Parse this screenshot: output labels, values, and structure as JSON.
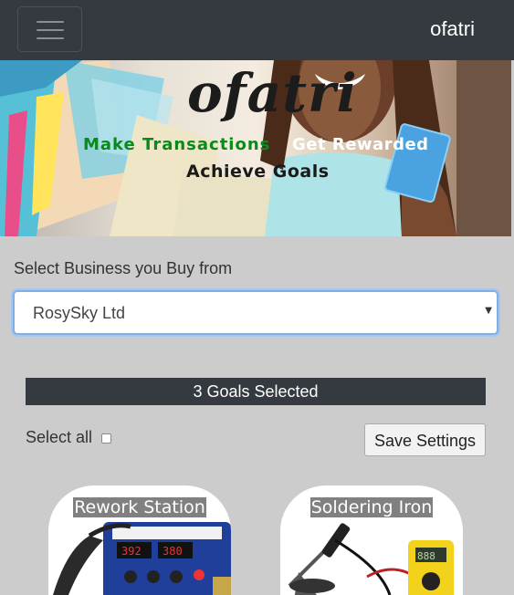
{
  "navbar": {
    "brand": "ofatri",
    "toggle_icon": "hamburger-menu-icon"
  },
  "hero": {
    "logo_text": "ofatri",
    "tagline_1": "Make Transactions",
    "tagline_2": "Get Rewarded",
    "tagline_3": "Achieve Goals",
    "colors": {
      "tagline_1": "#0a8a1a",
      "tagline_2": "#ffffff",
      "tagline_3": "#1a1a1a"
    }
  },
  "business": {
    "label": "Select Business you Buy from",
    "selected": "RosySky Ltd"
  },
  "goals": {
    "summary": "3 Goals Selected",
    "select_all_label": "Select all",
    "save_label": "Save Settings"
  },
  "products": [
    {
      "title": "Rework Station",
      "icon": "rework-station-image"
    },
    {
      "title": "Soldering Iron",
      "icon": "soldering-iron-image"
    }
  ]
}
